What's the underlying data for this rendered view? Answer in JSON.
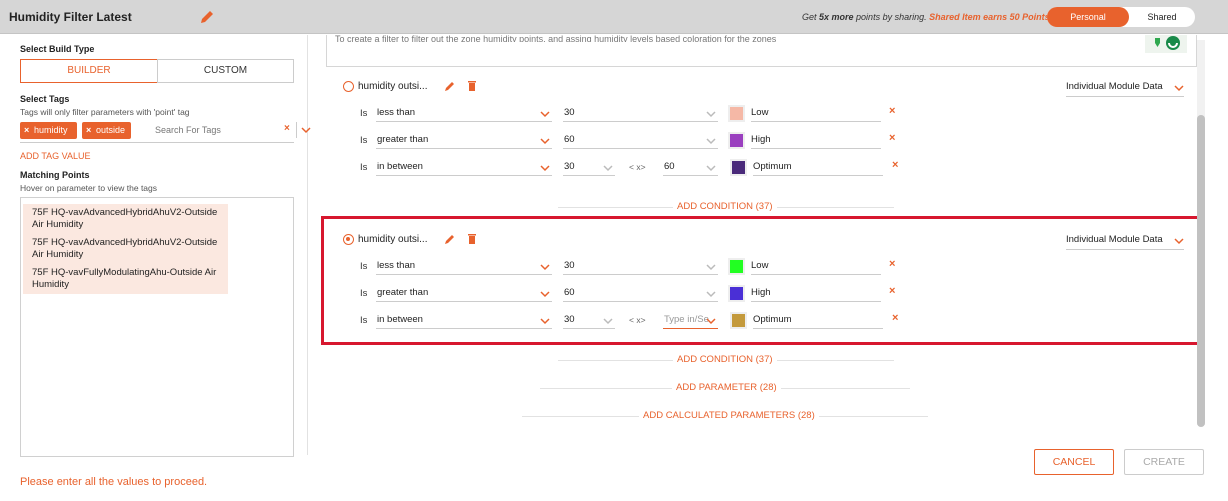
{
  "header": {
    "title": "Humidity Filter Latest",
    "share_prefix": "Get ",
    "share_bold": "5x more",
    "share_mid": " points by sharing. ",
    "share_highlight": "Shared Item earns 50 Points.",
    "toggle_personal": "Personal",
    "toggle_shared": "Shared"
  },
  "left": {
    "build_type_label": "Select Build Type",
    "builder_label": "BUILDER",
    "custom_label": "CUSTOM",
    "select_tags_label": "Select Tags",
    "tags_hint": "Tags will only filter parameters with 'point' tag",
    "tags": [
      "humidity",
      "outside"
    ],
    "tag_search_placeholder": "Search For Tags",
    "add_tag_value": "ADD TAG VALUE",
    "matching_points_label": "Matching Points",
    "matching_points_hint": "Hover on parameter to view the tags",
    "points": [
      "75F HQ-vavAdvancedHybridAhuV2-Outside Air Humidity",
      "75F HQ-vavAdvancedHybridAhuV2-Outside Air Humidity",
      "75F HQ-vavFullyModulatingAhu-Outside Air Humidity"
    ],
    "error_message": "Please enter all the values to proceed."
  },
  "main": {
    "description": "To create a filter to filter out the zone humidity points, and assing humidity levels based coloration for the zones",
    "groups": [
      {
        "name": "humidity outsi...",
        "module": "Individual Module Data",
        "conditions": [
          {
            "is": "Is",
            "op": "less than",
            "v1": "30",
            "color": "#f5b8a6",
            "label": "Low"
          },
          {
            "is": "Is",
            "op": "greater than",
            "v1": "60",
            "color": "#9a3fbf",
            "label": "High"
          },
          {
            "is": "Is",
            "op": "in between",
            "v1": "30",
            "sep": "< x>",
            "v2": "60",
            "color": "#4a2a7a",
            "label": "Optimum"
          }
        ],
        "add_condition": "ADD CONDITION (37)"
      },
      {
        "name": "humidity outsi...",
        "module": "Individual Module Data",
        "conditions": [
          {
            "is": "Is",
            "op": "less than",
            "v1": "30",
            "color": "#22ff22",
            "label": "Low"
          },
          {
            "is": "Is",
            "op": "greater than",
            "v1": "60",
            "color": "#4a2fd6",
            "label": "High"
          },
          {
            "is": "Is",
            "op": "in between",
            "v1": "30",
            "sep": "< x>",
            "v2_placeholder": "Type in/Se",
            "color": "#c49a3c",
            "label": "Optimum"
          }
        ],
        "add_condition": "ADD CONDITION (37)"
      }
    ],
    "add_parameter": "ADD PARAMETER (28)",
    "add_calculated": "ADD CALCULATED PARAMETERS (28)"
  },
  "footer": {
    "cancel": "CANCEL",
    "create": "CREATE"
  },
  "colors": {
    "accent": "#e8622d",
    "highlight_border": "#d7172f"
  }
}
